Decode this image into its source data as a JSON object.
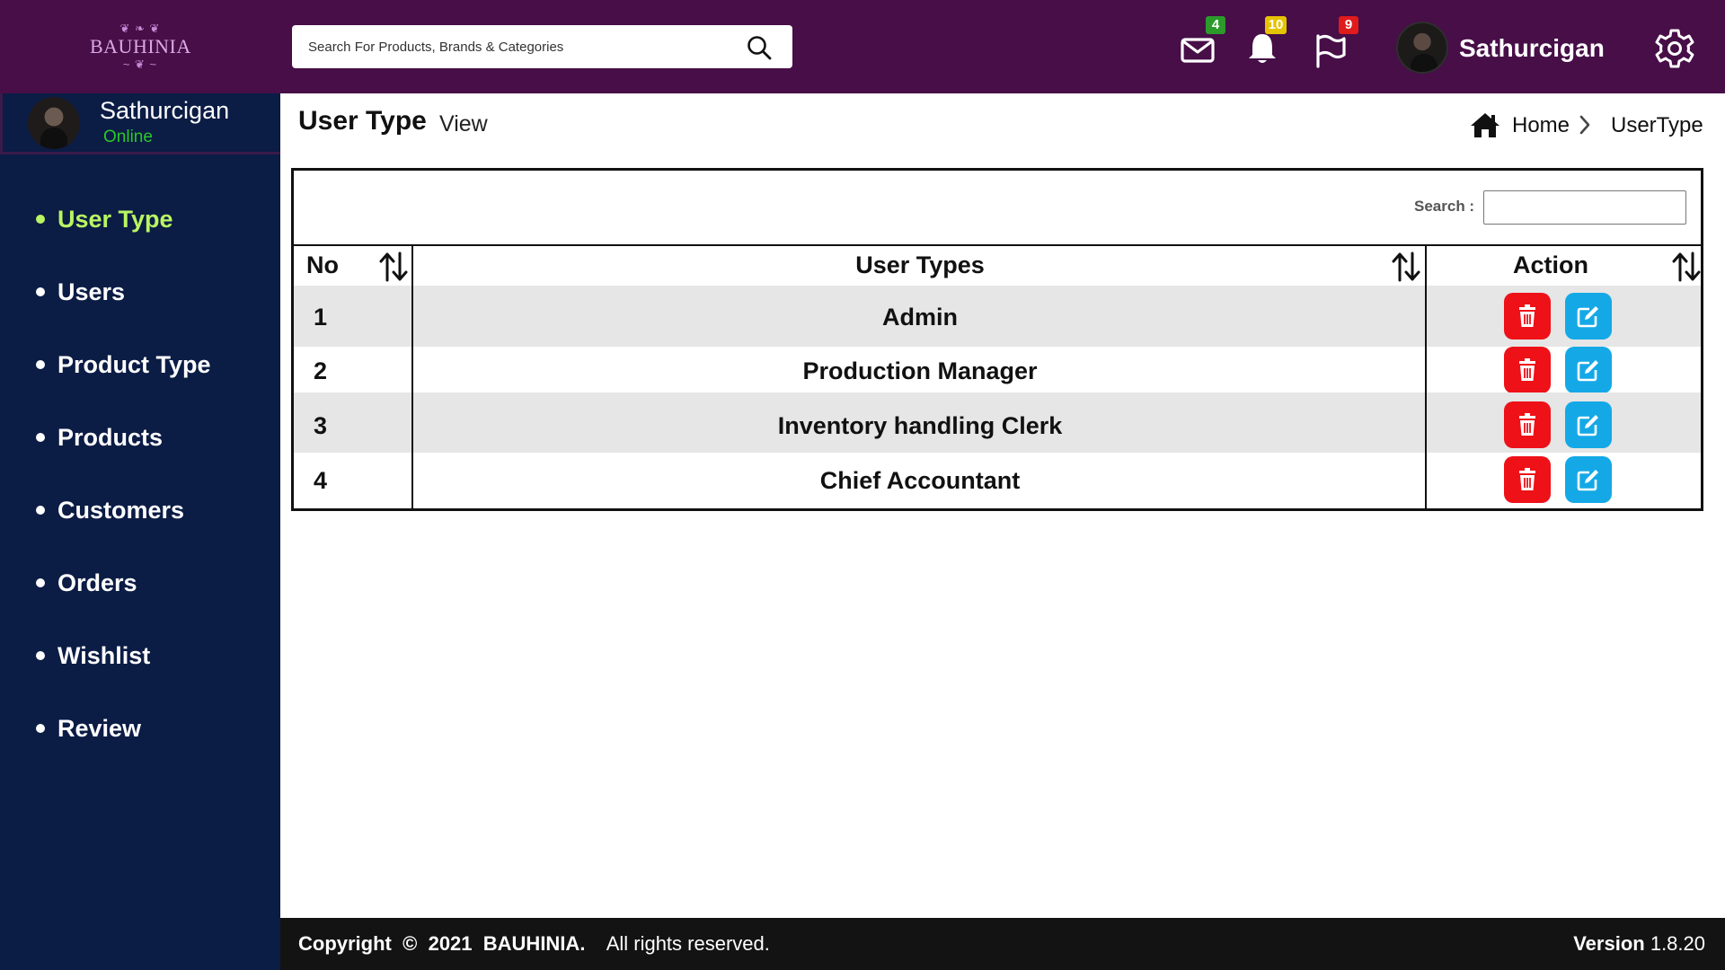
{
  "header": {
    "logo_text": "BAUHINIA",
    "search_placeholder": "Search For Products, Brands & Categories",
    "badges": {
      "messages": "4",
      "notifications": "10",
      "flags": "9"
    },
    "username": "Sathurcigan"
  },
  "sidebar": {
    "user_name": "Sathurcigan",
    "user_status": "Online",
    "items": [
      {
        "label": "User Type"
      },
      {
        "label": "Users"
      },
      {
        "label": "Product Type"
      },
      {
        "label": "Products"
      },
      {
        "label": "Customers"
      },
      {
        "label": "Orders"
      },
      {
        "label": "Wishlist"
      },
      {
        "label": "Review"
      }
    ]
  },
  "page": {
    "title": "User Type",
    "subtitle": "View",
    "breadcrumb": {
      "home": "Home",
      "current": "UserType"
    }
  },
  "table": {
    "search_label": "Search :",
    "columns": {
      "no": "No",
      "types": "User Types",
      "action": "Action"
    },
    "rows": [
      {
        "no": "1",
        "type": "Admin"
      },
      {
        "no": "2",
        "type": "Production Manager"
      },
      {
        "no": "3",
        "type": "Inventory handling Clerk"
      },
      {
        "no": "4",
        "type": "Chief Accountant"
      }
    ]
  },
  "footer": {
    "copyright_label": "Copyright",
    "copyright_symbol": "©",
    "year": "2021",
    "brand": "BAUHINIA.",
    "rights": "All rights reserved.",
    "version_label": "Version",
    "version": "1.8.20"
  },
  "colors": {
    "topbar": "#470e47",
    "sidebar": "#0b1c45",
    "active_nav": "#b9f562",
    "online": "#28c928",
    "delete_button": "#ee1118",
    "edit_button": "#14a9e6",
    "footer": "#131313"
  },
  "icons": {
    "search": "search-icon",
    "mail": "mail-icon",
    "bell": "bell-icon",
    "flag": "flag-icon",
    "settings": "gear-icon",
    "home": "home-icon",
    "sort": "sort-icon",
    "delete": "trash-icon",
    "edit": "edit-icon"
  }
}
